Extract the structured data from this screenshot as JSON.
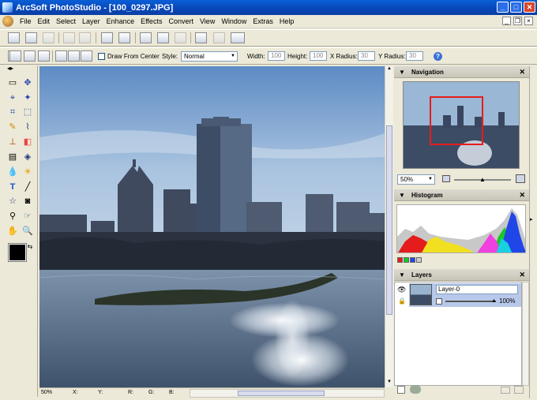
{
  "window": {
    "title": "ArcSoft PhotoStudio - [100_0297.JPG]"
  },
  "menu": [
    "File",
    "Edit",
    "Select",
    "Layer",
    "Enhance",
    "Effects",
    "Convert",
    "View",
    "Window",
    "Extras",
    "Help"
  ],
  "options": {
    "draw_from_center": "Draw From Center",
    "style_label": "Style:",
    "style_value": "Normal",
    "width_label": "Width:",
    "width_value": "100",
    "height_label": "Height:",
    "height_value": "100",
    "xradius_label": "X Radius:",
    "xradius_value": "30",
    "yradius_label": "Y Radius:",
    "yradius_value": "30"
  },
  "status": {
    "zoom": "50%",
    "x": "X:",
    "y": "Y:",
    "r": "R:",
    "g": "G:",
    "b": "B:"
  },
  "navigation": {
    "title": "Navigation",
    "zoom": "50%"
  },
  "histogram": {
    "title": "Histogram"
  },
  "layers": {
    "title": "Layers",
    "layer_name": "Layer-0",
    "opacity": "100%"
  },
  "colors": {
    "accent": "#0a5fd6",
    "selection": "#e81c1c",
    "layer_highlight": "#b8c8ea"
  }
}
